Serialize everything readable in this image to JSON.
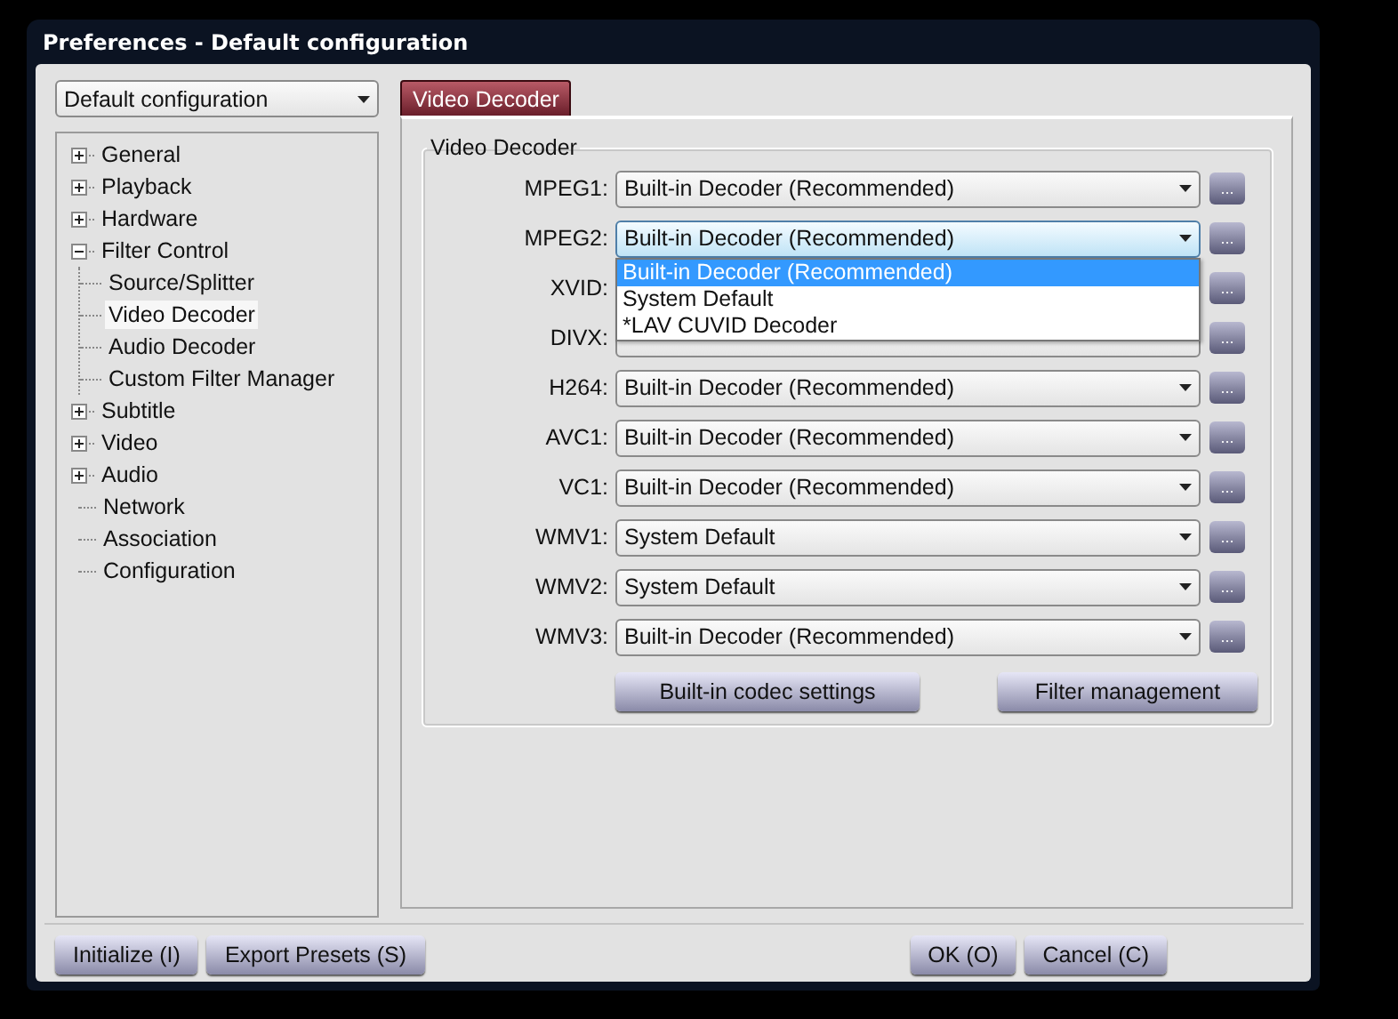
{
  "window": {
    "title": "Preferences - Default configuration"
  },
  "preset": {
    "value": "Default configuration"
  },
  "tree": [
    {
      "label": "General",
      "expanded": false,
      "selected": false
    },
    {
      "label": "Playback",
      "expanded": false,
      "selected": false
    },
    {
      "label": "Hardware",
      "expanded": false,
      "selected": false
    },
    {
      "label": "Filter Control",
      "expanded": true,
      "selected": false,
      "children": [
        {
          "label": "Source/Splitter",
          "selected": false
        },
        {
          "label": "Video Decoder",
          "selected": true
        },
        {
          "label": "Audio Decoder",
          "selected": false
        },
        {
          "label": "Custom Filter Manager",
          "selected": false
        }
      ]
    },
    {
      "label": "Subtitle",
      "expanded": false,
      "selected": false
    },
    {
      "label": "Video",
      "expanded": false,
      "selected": false
    },
    {
      "label": "Audio",
      "expanded": false,
      "selected": false
    },
    {
      "label": "Network",
      "selected": false
    },
    {
      "label": "Association",
      "selected": false
    },
    {
      "label": "Configuration",
      "selected": false
    }
  ],
  "tab": {
    "label": "Video Decoder"
  },
  "group": {
    "title": "Video Decoder",
    "rows": [
      {
        "label": "MPEG1:",
        "value": "Built-in Decoder (Recommended)",
        "open": false,
        "more": "..."
      },
      {
        "label": "MPEG2:",
        "value": "Built-in Decoder (Recommended)",
        "open": true,
        "more": "...",
        "options": [
          {
            "label": "Built-in Decoder (Recommended)",
            "selected": true
          },
          {
            "label": "System Default",
            "selected": false
          },
          {
            "label": "*LAV CUVID Decoder",
            "selected": false
          }
        ]
      },
      {
        "label": "XVID:",
        "open": false,
        "more": "..."
      },
      {
        "label": "DIVX:",
        "open": false,
        "more": "..."
      },
      {
        "label": "H264:",
        "value": "Built-in Decoder (Recommended)",
        "open": false,
        "more": "..."
      },
      {
        "label": "AVC1:",
        "value": "Built-in Decoder (Recommended)",
        "open": false,
        "more": "..."
      },
      {
        "label": "VC1:",
        "value": "Built-in Decoder (Recommended)",
        "open": false,
        "more": "..."
      },
      {
        "label": "WMV1:",
        "value": "System Default",
        "open": false,
        "more": "..."
      },
      {
        "label": "WMV2:",
        "value": "System Default",
        "open": false,
        "more": "..."
      },
      {
        "label": "WMV3:",
        "value": "Built-in Decoder (Recommended)",
        "open": false,
        "more": "..."
      }
    ],
    "buttons": [
      "Built-in codec settings",
      "Filter management"
    ]
  },
  "footer": {
    "left_buttons": [
      "Initialize (I)",
      "Export Presets (S)"
    ],
    "right_buttons": [
      "OK (O)",
      "Cancel (C)"
    ]
  }
}
